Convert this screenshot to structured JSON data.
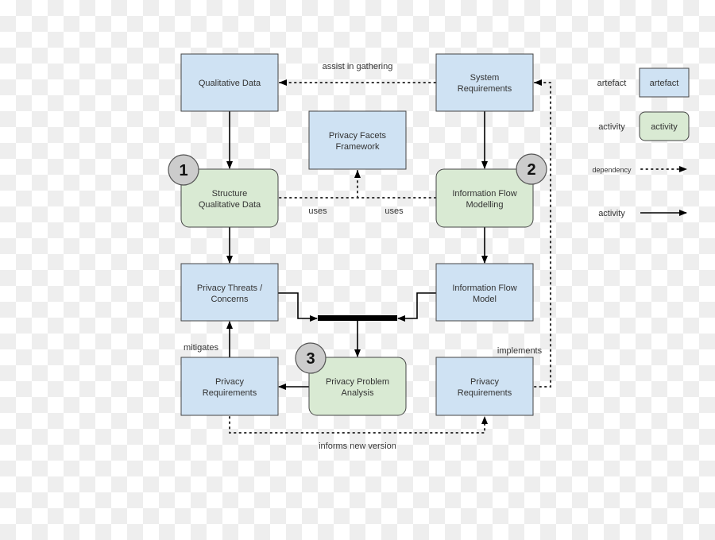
{
  "colors": {
    "artefact": "#cfe2f3",
    "activity": "#d9ead3",
    "badge": "#cccccc"
  },
  "nodes": {
    "qualitative_data": {
      "lines": [
        "Qualitative Data"
      ]
    },
    "system_requirements": {
      "lines": [
        "System",
        "Requirements"
      ]
    },
    "privacy_facets": {
      "lines": [
        "Privacy Facets",
        "Framework"
      ]
    },
    "structure_qd": {
      "lines": [
        "Structure",
        "Qualitative Data"
      ],
      "badge": "1"
    },
    "info_flow_modelling": {
      "lines": [
        "Information Flow",
        "Modelling"
      ],
      "badge": "2"
    },
    "privacy_threats": {
      "lines": [
        "Privacy Threats /",
        "Concerns"
      ]
    },
    "info_flow_model": {
      "lines": [
        "Information Flow",
        "Model"
      ]
    },
    "privacy_problem": {
      "lines": [
        "Privacy Problem",
        "Analysis"
      ],
      "badge": "3"
    },
    "privacy_req_left": {
      "lines": [
        "Privacy",
        "Requirements"
      ]
    },
    "privacy_req_right": {
      "lines": [
        "Privacy",
        "Requirements"
      ]
    }
  },
  "edge_labels": {
    "assist": "assist in gathering",
    "uses_left": "uses",
    "uses_right": "uses",
    "mitigates": "mitigates",
    "implements": "implements",
    "informs": "informs new version"
  },
  "legend": {
    "artefact_label": "artefact",
    "artefact_box": "artefact",
    "activity_label": "activity",
    "activity_box": "activity",
    "dependency_label": "dependency",
    "activity_arrow_label": "activity"
  }
}
